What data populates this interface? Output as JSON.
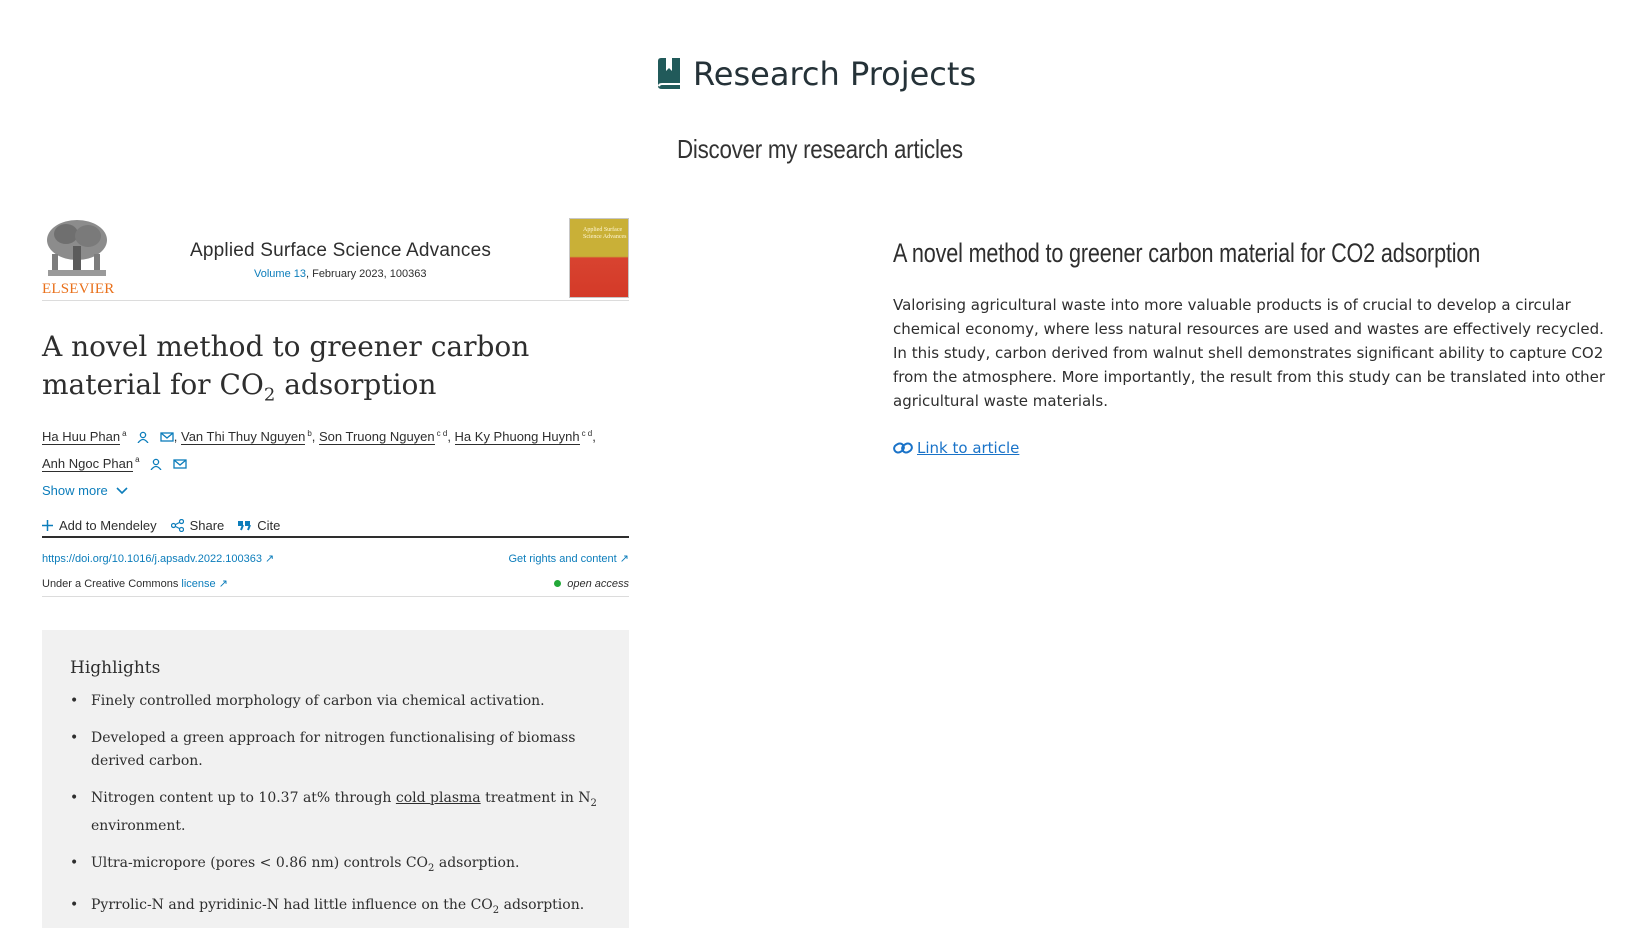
{
  "header": {
    "title": "Research Projects",
    "subtitle": "Discover my research articles"
  },
  "article_card": {
    "publisher": "ELSEVIER",
    "journal_name": "Applied Surface Science Advances",
    "volume_link": "Volume 13",
    "volume_rest": ", February 2023, 100363",
    "cover_text": "Applied Surface Science Advances",
    "title_part1": "A novel method to greener carbon material for CO",
    "title_sub": "2",
    "title_part2": " adsorption",
    "authors": [
      {
        "name": "Ha Huu Phan",
        "sup": "a",
        "icons": [
          "person-icon",
          "mail-icon"
        ]
      },
      {
        "name": "Van Thi Thuy Nguyen",
        "sup": "b",
        "icons": []
      },
      {
        "name": "Son Truong Nguyen",
        "sup": "c d",
        "icons": []
      },
      {
        "name": "Ha Ky Phuong Huynh",
        "sup": "c d",
        "icons": []
      },
      {
        "name": "Anh Ngoc Phan",
        "sup": "a",
        "icons": [
          "person-icon",
          "mail-icon"
        ]
      }
    ],
    "show_more": "Show more",
    "actions": {
      "mendeley": "Add to Mendeley",
      "share": "Share",
      "cite": "Cite"
    },
    "doi": "https://doi.org/10.1016/j.apsadv.2022.100363",
    "rights": "Get rights and content",
    "license_prefix": "Under a Creative Commons ",
    "license_link": "license",
    "open_access": "open access",
    "highlights_title": "Highlights",
    "highlights": [
      {
        "pre": "Finely controlled morphology of carbon via chemical activation.",
        "ul": "",
        "mid": "",
        "sub": "",
        "post": ""
      },
      {
        "pre": "Developed a green approach for nitrogen functionalising of biomass derived carbon.",
        "ul": "",
        "mid": "",
        "sub": "",
        "post": ""
      },
      {
        "pre": "Nitrogen content up to 10.37 at% through ",
        "ul": "cold plasma",
        "mid": " treatment in N",
        "sub": "2",
        "post": " environment."
      },
      {
        "pre": "Ultra-micropore (pores < 0.86 nm) controls CO",
        "ul": "",
        "mid": "",
        "sub": "2",
        "post": " adsorption."
      },
      {
        "pre": "Pyrrolic-N and pyridinic-N had little influence on the CO",
        "ul": "",
        "mid": "",
        "sub": "2",
        "post": " adsorption."
      }
    ]
  },
  "description": {
    "title": "A novel method to greener carbon material for CO2 adsorption",
    "body": "Valorising agricultural waste into more valuable products is of crucial to develop a circular chemical economy, where less natural resources are used and wastes are effectively recycled. In this study, carbon derived from walnut shell demonstrates significant ability to capture CO2 from the atmosphere. More importantly, the result from this study can be translated into other agricultural waste materials.",
    "link_label": " Link to article"
  },
  "colors": {
    "accent_link": "#1a73c8",
    "elsevier_orange": "#e9711c",
    "sd_blue": "#0c7dbb",
    "open_access_green": "#22a838",
    "header_icon": "#253238"
  }
}
